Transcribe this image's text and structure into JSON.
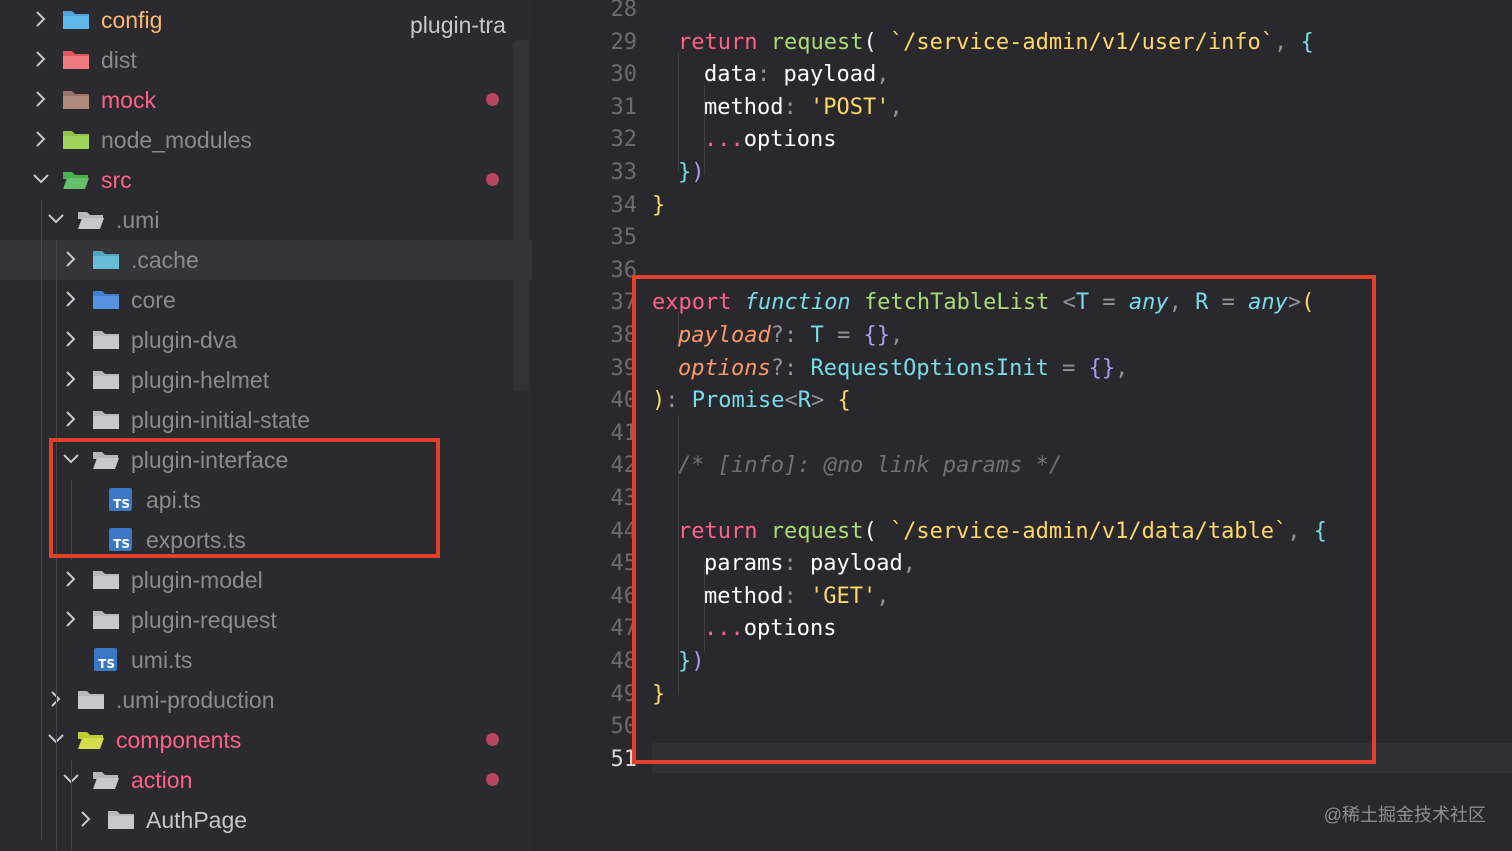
{
  "colors": {
    "accent_red": "#e2412c",
    "modified_dot": "#b4475d",
    "folder_grey": "#c6c6ca",
    "ts_blue": "#3a78c6"
  },
  "sidebar": {
    "tooltip": "plugin-tra",
    "rows": [
      {
        "label": "config",
        "color": "#ffb86c",
        "icon": "config-folder-icon",
        "state": "collapsed"
      },
      {
        "label": "dist",
        "color": "#8a8a90",
        "icon": "dist-folder-icon",
        "state": "collapsed"
      },
      {
        "label": "mock",
        "color": "#ff6188",
        "icon": "mock-folder-icon",
        "state": "collapsed",
        "modified": true
      },
      {
        "label": "node_modules",
        "color": "#8a8a90",
        "icon": "node-modules-folder-icon",
        "state": "collapsed"
      },
      {
        "label": "src",
        "color": "#ff6188",
        "icon": "src-folder-icon",
        "state": "expanded",
        "modified": true
      },
      {
        "label": ".umi",
        "color": "#8a8a90",
        "icon": "folder-icon",
        "state": "expanded"
      },
      {
        "label": ".cache",
        "color": "#8a8a90",
        "icon": "cache-folder-icon",
        "state": "collapsed"
      },
      {
        "label": "core",
        "color": "#8a8a90",
        "icon": "core-folder-icon",
        "state": "collapsed"
      },
      {
        "label": "plugin-dva",
        "color": "#8a8a90",
        "icon": "folder-icon",
        "state": "collapsed"
      },
      {
        "label": "plugin-helmet",
        "color": "#8a8a90",
        "icon": "folder-icon",
        "state": "collapsed"
      },
      {
        "label": "plugin-initial-state",
        "color": "#8a8a90",
        "icon": "folder-icon",
        "state": "collapsed"
      },
      {
        "label": "plugin-interface",
        "color": "#8a8a90",
        "icon": "folder-open-icon",
        "state": "expanded"
      },
      {
        "label": "api.ts",
        "color": "#8a8a90",
        "icon": "typescript-file-icon",
        "state": "file"
      },
      {
        "label": "exports.ts",
        "color": "#8a8a90",
        "icon": "typescript-file-icon",
        "state": "file"
      },
      {
        "label": "plugin-model",
        "color": "#8a8a90",
        "icon": "folder-icon",
        "state": "collapsed"
      },
      {
        "label": "plugin-request",
        "color": "#8a8a90",
        "icon": "folder-icon",
        "state": "collapsed"
      },
      {
        "label": "umi.ts",
        "color": "#8a8a90",
        "icon": "typescript-file-icon",
        "state": "file"
      },
      {
        "label": ".umi-production",
        "color": "#8a8a90",
        "icon": "folder-icon",
        "state": "collapsed"
      },
      {
        "label": "components",
        "color": "#ff6188",
        "icon": "components-folder-icon",
        "state": "expanded",
        "modified": true
      },
      {
        "label": "action",
        "color": "#ff6188",
        "icon": "folder-open-icon",
        "state": "expanded",
        "modified": true
      },
      {
        "label": "AuthPage",
        "color": "#c6c6ca",
        "icon": "folder-icon",
        "state": "collapsed"
      }
    ]
  },
  "editor": {
    "line_numbers": [
      "28",
      "29",
      "30",
      "31",
      "32",
      "33",
      "34",
      "35",
      "36",
      "37",
      "38",
      "39",
      "40",
      "41",
      "42",
      "43",
      "44",
      "45",
      "46",
      "47",
      "48",
      "49",
      "50",
      "51"
    ],
    "active_line": "51",
    "lines": [
      [],
      [
        [
          "k",
          "return "
        ],
        [
          "f",
          "request"
        ],
        [
          "w",
          "( "
        ],
        [
          "s",
          "`/service-admin/v1/user/info`"
        ],
        [
          "p",
          ", "
        ],
        [
          "b",
          "{"
        ]
      ],
      [
        [
          "w",
          "data"
        ],
        [
          "p",
          ": "
        ],
        [
          "w",
          "payload"
        ],
        [
          "p",
          ","
        ]
      ],
      [
        [
          "w",
          "method"
        ],
        [
          "p",
          ": "
        ],
        [
          "s",
          "'POST'"
        ],
        [
          "p",
          ","
        ]
      ],
      [
        [
          "pk",
          "..."
        ],
        [
          "w",
          "options"
        ]
      ],
      [
        [
          "b",
          "}"
        ],
        [
          "m",
          ")"
        ]
      ],
      [
        [
          "y",
          "}"
        ]
      ],
      [],
      [],
      [
        [
          "k",
          "export "
        ],
        [
          "ia",
          "function "
        ],
        [
          "f",
          "fetchTableList "
        ],
        [
          "p",
          "<"
        ],
        [
          "t",
          "T"
        ],
        [
          "p",
          " = "
        ],
        [
          "ia",
          "any"
        ],
        [
          "p",
          ", "
        ],
        [
          "t",
          "R"
        ],
        [
          "p",
          " = "
        ],
        [
          "ia",
          "any"
        ],
        [
          "p",
          ">"
        ],
        [
          "y",
          "("
        ]
      ],
      [
        [
          "i",
          "payload"
        ],
        [
          "p",
          "?: "
        ],
        [
          "t",
          "T"
        ],
        [
          "p",
          " = "
        ],
        [
          "m",
          "{}"
        ],
        [
          "p",
          ","
        ]
      ],
      [
        [
          "i",
          "options"
        ],
        [
          "p",
          "?: "
        ],
        [
          "t",
          "RequestOptionsInit"
        ],
        [
          "p",
          " = "
        ],
        [
          "m",
          "{}"
        ],
        [
          "p",
          ","
        ]
      ],
      [
        [
          "y",
          ")"
        ],
        [
          "p",
          ": "
        ],
        [
          "t",
          "Promise"
        ],
        [
          "p",
          "<"
        ],
        [
          "t",
          "R"
        ],
        [
          "p",
          "> "
        ],
        [
          "y",
          "{"
        ]
      ],
      [],
      [
        [
          "c",
          "/* [info]: @no link params */"
        ]
      ],
      [],
      [
        [
          "k",
          "return "
        ],
        [
          "f",
          "request"
        ],
        [
          "w",
          "( "
        ],
        [
          "s",
          "`/service-admin/v1/data/table`"
        ],
        [
          "p",
          ", "
        ],
        [
          "b",
          "{"
        ]
      ],
      [
        [
          "w",
          "params"
        ],
        [
          "p",
          ": "
        ],
        [
          "w",
          "payload"
        ],
        [
          "p",
          ","
        ]
      ],
      [
        [
          "w",
          "method"
        ],
        [
          "p",
          ": "
        ],
        [
          "s",
          "'GET'"
        ],
        [
          "p",
          ","
        ]
      ],
      [
        [
          "pk",
          "..."
        ],
        [
          "w",
          "options"
        ]
      ],
      [
        [
          "b",
          "}"
        ],
        [
          "m",
          ")"
        ]
      ],
      [
        [
          "y",
          "}"
        ]
      ],
      [],
      []
    ]
  },
  "watermark": "@稀土掘金技术社区"
}
